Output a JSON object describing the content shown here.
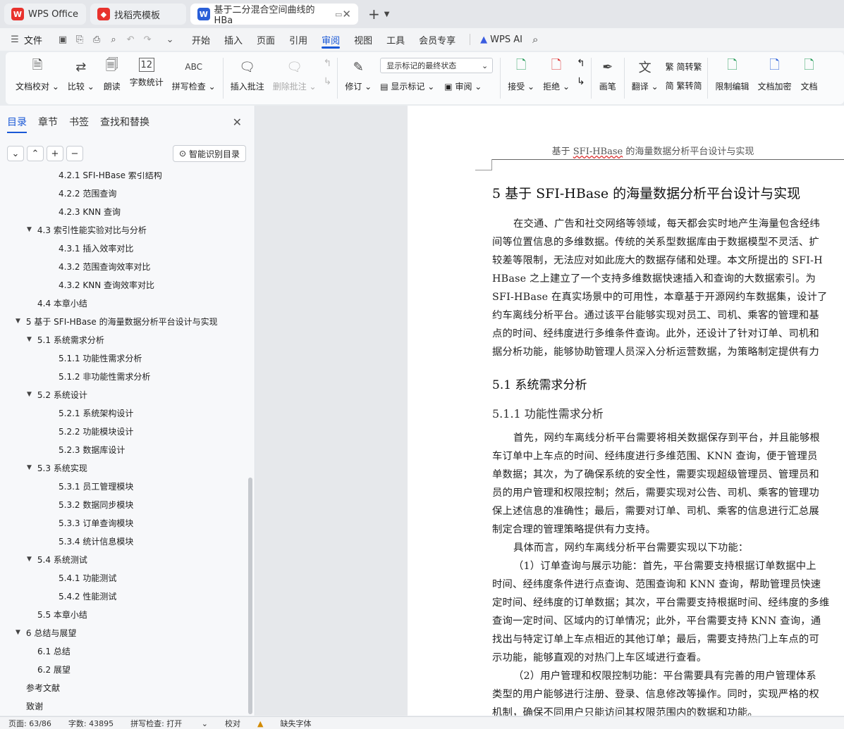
{
  "tabs": [
    {
      "label": "WPS Office",
      "icon": "wps-logo-icon"
    },
    {
      "label": "找稻壳模板",
      "icon": "daoke-logo-icon"
    },
    {
      "label": "基于二分混合空间曲线的HBa",
      "icon": "writer-doc-icon"
    }
  ],
  "menu": {
    "file": "文件",
    "items": [
      "开始",
      "插入",
      "页面",
      "引用",
      "审阅",
      "视图",
      "工具",
      "会员专享"
    ],
    "active": "审阅",
    "wps_ai": "WPS AI"
  },
  "ribbon": {
    "doc_check": "文档校对",
    "compare": "比较",
    "read_aloud": "朗读",
    "word_count": "字数统计",
    "spell_check": "拼写检查",
    "spell_icon_text": "ABC",
    "insert_comment": "插入批注",
    "delete_comment": "删除批注",
    "track": "修订",
    "markup_dropdown": "显示标记的最终状态",
    "show_markup": "显示标记",
    "review_pane": "审阅",
    "accept": "接受",
    "reject": "拒绝",
    "pen": "画笔",
    "translate": "翻译",
    "to_traditional": "简转繁",
    "to_simplified": "繁转简",
    "restrict_edit": "限制编辑",
    "encrypt": "文档加密",
    "doc_more": "文档"
  },
  "panel": {
    "tabs": [
      "目录",
      "章节",
      "书签",
      "查找和替换"
    ],
    "active_tab": "目录",
    "smart_toc": "智能识别目录",
    "toc": [
      {
        "text": "4.2.1 SFI-HBase 索引结构",
        "level": 3,
        "expanded": null
      },
      {
        "text": "4.2.2  范围查询",
        "level": 3,
        "expanded": null
      },
      {
        "text": "4.2.3 KNN 查询",
        "level": 3,
        "expanded": null
      },
      {
        "text": "4.3 索引性能实验对比与分析",
        "level": 2,
        "expanded": true
      },
      {
        "text": "4.3.1  插入效率对比",
        "level": 3,
        "expanded": null
      },
      {
        "text": "4.3.2  范围查询效率对比",
        "level": 3,
        "expanded": null
      },
      {
        "text": "4.3.2 KNN 查询效率对比",
        "level": 3,
        "expanded": null
      },
      {
        "text": "4.4  本章小结",
        "level": 2,
        "expanded": null
      },
      {
        "text": "5  基于 SFI-HBase 的海量数据分析平台设计与实现",
        "level": 1,
        "expanded": true
      },
      {
        "text": "5.1  系统需求分析",
        "level": 2,
        "expanded": true
      },
      {
        "text": "5.1.1  功能性需求分析",
        "level": 3,
        "expanded": null
      },
      {
        "text": "5.1.2  非功能性需求分析",
        "level": 3,
        "expanded": null
      },
      {
        "text": "5.2  系统设计",
        "level": 2,
        "expanded": true
      },
      {
        "text": "5.2.1  系统架构设计",
        "level": 3,
        "expanded": null
      },
      {
        "text": "5.2.2  功能模块设计",
        "level": 3,
        "expanded": null
      },
      {
        "text": "5.2.3  数据库设计",
        "level": 3,
        "expanded": null
      },
      {
        "text": "5.3 系统实现",
        "level": 2,
        "expanded": true
      },
      {
        "text": "5.3.1  员工管理模块",
        "level": 3,
        "expanded": null
      },
      {
        "text": "5.3.2  数据同步模块",
        "level": 3,
        "expanded": null
      },
      {
        "text": "5.3.3  订单查询模块",
        "level": 3,
        "expanded": null
      },
      {
        "text": "5.3.4  统计信息模块",
        "level": 3,
        "expanded": null
      },
      {
        "text": "5.4  系统测试",
        "level": 2,
        "expanded": true
      },
      {
        "text": "5.4.1  功能测试",
        "level": 3,
        "expanded": null
      },
      {
        "text": "5.4.2  性能测试",
        "level": 3,
        "expanded": null
      },
      {
        "text": "5.5  本章小结",
        "level": 2,
        "expanded": null
      },
      {
        "text": "6  总结与展望",
        "level": 1,
        "expanded": true
      },
      {
        "text": "6.1  总结",
        "level": 2,
        "expanded": null
      },
      {
        "text": "6.2  展望",
        "level": 2,
        "expanded": null
      },
      {
        "text": "参考文献",
        "level": 1,
        "expanded": null
      },
      {
        "text": "致谢",
        "level": 1,
        "expanded": null
      }
    ]
  },
  "document": {
    "header_pre": "基于 ",
    "header_u": "SFI-HBase",
    "header_post": " 的海量数据分析平台设计与实现",
    "chapter_title": "5  基于 SFI-HBase 的海量数据分析平台设计与实现",
    "intro_lines": [
      "在交通、广告和社交网络等领域，每天都会实时地产生海量包含经纬",
      "间等位置信息的多维数据。传统的关系型数据库由于数据模型不灵活、扩",
      "较差等限制，无法应对如此庞大的数据存储和处理。本文所提出的 SFI-H",
      "HBase 之上建立了一个支持多维数据快速插入和查询的大数据索引。为",
      "SFI-HBase 在真实场景中的可用性，本章基于开源网约车数据集，设计了",
      "约车离线分析平台。通过该平台能够实现对员工、司机、乘客的管理和基",
      "点的时间、经纬度进行多维条件查询。此外，还设计了针对订单、司机和",
      "据分析功能，能够协助管理人员深入分析运营数据，为策略制定提供有力"
    ],
    "section_title": "5.1  系统需求分析",
    "subsection_title": "5.1.1  功能性需求分析",
    "body_lines": [
      "首先，网约车离线分析平台需要将相关数据保存到平台，并且能够根",
      "车订单中上车点的时间、经纬度进行多维范围、KNN 查询，便于管理员",
      "单数据；其次，为了确保系统的安全性，需要实现超级管理员、管理员和",
      "员的用户管理和权限控制；然后，需要实现对公告、司机、乘客的管理功",
      "保上述信息的准确性；最后，需要对订单、司机、乘客的信息进行汇总展",
      "制定合理的管理策略提供有力支持。",
      "具体而言，网约车离线分析平台需要实现以下功能：",
      "（1）订单查询与展示功能：首先，平台需要支持根据订单数据中上",
      "时间、经纬度条件进行点查询、范围查询和 KNN 查询，帮助管理员快速",
      "定时间、经纬度的订单数据；其次，平台需要支持根据时间、经纬度的多维",
      "查询一定时间、区域内的订单情况；此外，平台需要支持 KNN 查询，通",
      "找出与特定订单上车点相近的其他订单；最后，需要支持热门上车点的可",
      "示功能，能够直观的对热门上车区域进行查看。",
      "（2）用户管理和权限控制功能：平台需要具有完善的用户管理体系",
      "类型的用户能够进行注册、登录、信息修改等操作。同时，实现严格的权",
      "机制，确保不同用户只能访问其权限范围内的数据和功能。"
    ]
  },
  "status": {
    "page": "页面: 63/86",
    "words": "字数: 43895",
    "spell": "拼写检查: 打开",
    "proof": "校对",
    "missing_font": "缺失字体"
  }
}
